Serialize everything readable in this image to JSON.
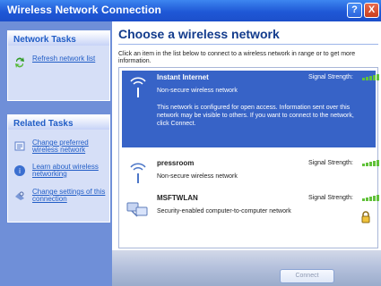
{
  "window": {
    "title": "Wireless Network Connection",
    "help_label": "?",
    "close_label": "X"
  },
  "network_tasks": {
    "title": "Network Tasks",
    "items": [
      {
        "label": "Refresh network list",
        "icon": "refresh-icon"
      }
    ]
  },
  "related_tasks": {
    "title": "Related Tasks",
    "items": [
      {
        "label": "Change preferred wireless network",
        "icon": "preferred-network-icon"
      },
      {
        "label": "Learn about wireless networking",
        "icon": "info-icon"
      },
      {
        "label": "Change settings of this connection",
        "icon": "settings-icon"
      }
    ]
  },
  "main": {
    "heading": "Choose a wireless network",
    "instruction": "Click an item in the list below to connect to a wireless network in range or to get more information.",
    "networks": [
      {
        "name": "Instant Internet",
        "security": "Non-secure wireless network",
        "signal_label": "Signal Strength:",
        "signal_level": 5,
        "selected": true,
        "note": "This network is configured for open access. Information sent over this network may be visible to others. If you want to connect to the network, click Connect."
      },
      {
        "name": "pressroom",
        "security": "Non-secure wireless network",
        "signal_label": "Signal Strength:",
        "signal_level": 5,
        "selected": false
      },
      {
        "name": "MSFTWLAN",
        "security": "Security-enabled computer-to-computer network",
        "signal_label": "Signal Strength:",
        "signal_level": 5,
        "selected": false
      }
    ],
    "connect_label": "Connect"
  },
  "colors": {
    "title_bar": "#1f58d6",
    "selection": "#3763c7",
    "signal": "#61c13a",
    "task_link": "#215dc6"
  }
}
